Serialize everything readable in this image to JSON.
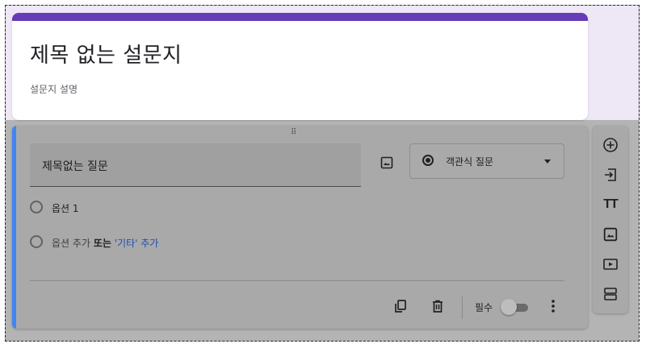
{
  "form": {
    "title": "제목 없는 설문지",
    "description": "설문지 설명",
    "accent_color": "#673ab7"
  },
  "question": {
    "title": "제목없는 질문",
    "type_label": "객관식 질문",
    "options": [
      {
        "label": "옵션 1"
      }
    ],
    "add_option_label": "옵션 추가",
    "or_label": "또는",
    "add_other_label": "'기타' 추가",
    "required_label": "필수",
    "required_on": false
  },
  "icons": {
    "question_image": "image-icon",
    "duplicate": "copy-icon",
    "delete": "trash-icon",
    "more": "more-vert-icon",
    "toolbar": [
      "add-circle-icon",
      "import-icon",
      "title-icon",
      "image-icon",
      "video-icon",
      "section-icon"
    ]
  },
  "toolbar": {
    "title_glyph": "TT"
  }
}
